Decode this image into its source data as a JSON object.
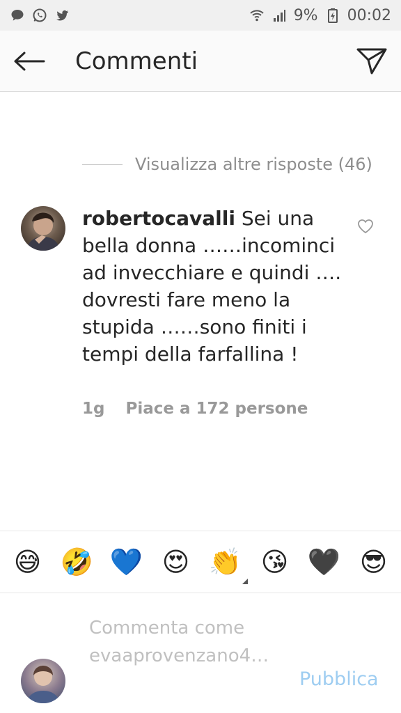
{
  "status_bar": {
    "battery": "9%",
    "time": "00:02",
    "icons": [
      "chat-bubble-icon",
      "whatsapp-icon",
      "twitter-icon",
      "wifi-icon",
      "signal-icon",
      "battery-icon"
    ]
  },
  "header": {
    "title": "Commenti",
    "back_icon": "arrow-left-icon",
    "share_icon": "paper-plane-icon"
  },
  "thread": {
    "view_more_label": "Visualizza altre risposte (46)"
  },
  "comment": {
    "username": "robertocavalli",
    "text": "Sei una bella donna ……incominci ad invecchiare e quindi …. dovresti fare meno la stupida ……sono finiti i tempi della farfallina !",
    "time": "1g",
    "likes": "Piace a 172 persone"
  },
  "emoji_bar": [
    "😅",
    "🤣",
    "💙",
    "😍",
    "👏",
    "😘",
    "🖤",
    "😎"
  ],
  "composer": {
    "placeholder": "Commenta come evaaprovenzano4…",
    "publish_label": "Pubblica"
  },
  "colors": {
    "status_bg": "#f0f0f0",
    "header_bg": "#fafafa",
    "publish": "#9ecdf1",
    "muted": "#8e8e8e"
  }
}
